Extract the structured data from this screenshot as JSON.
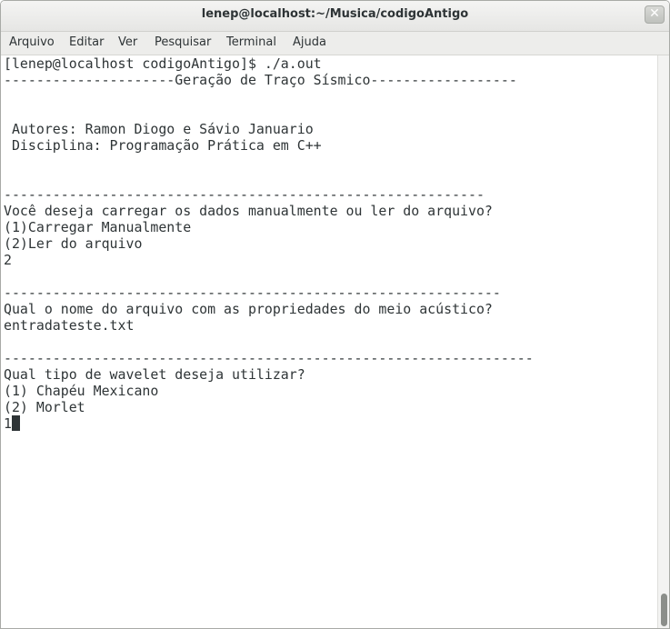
{
  "window": {
    "title": "lenep@localhost:~/Musica/codigoAntigo",
    "close_glyph": "✕"
  },
  "menubar": {
    "items": [
      {
        "label": "Arquivo"
      },
      {
        "label": "Editar"
      },
      {
        "label": "Ver"
      },
      {
        "label": "Pesquisar"
      },
      {
        "label": "Terminal"
      },
      {
        "label": "Ajuda"
      }
    ]
  },
  "terminal": {
    "lines": [
      "[lenep@localhost codigoAntigo]$ ./a.out",
      "---------------------Geração de Traço Sísmico------------------",
      "",
      "",
      " Autores: Ramon Diogo e Sávio Januario",
      " Disciplina: Programação Prática em C++",
      "",
      "",
      "-----------------------------------------------------------",
      "Você deseja carregar os dados manualmente ou ler do arquivo?",
      "(1)Carregar Manualmente",
      "(2)Ler do arquivo",
      "2",
      "",
      "-------------------------------------------------------------",
      "Qual o nome do arquivo com as propriedades do meio acústico?",
      "entradateste.txt",
      "",
      "-----------------------------------------------------------------",
      "Qual tipo de wavelet deseja utilizar?",
      "(1) Chapéu Mexicano",
      "(2) Morlet",
      "1"
    ]
  },
  "colors": {
    "text": "#2e3436",
    "background": "#ffffff",
    "cursor": "#2e3436"
  }
}
